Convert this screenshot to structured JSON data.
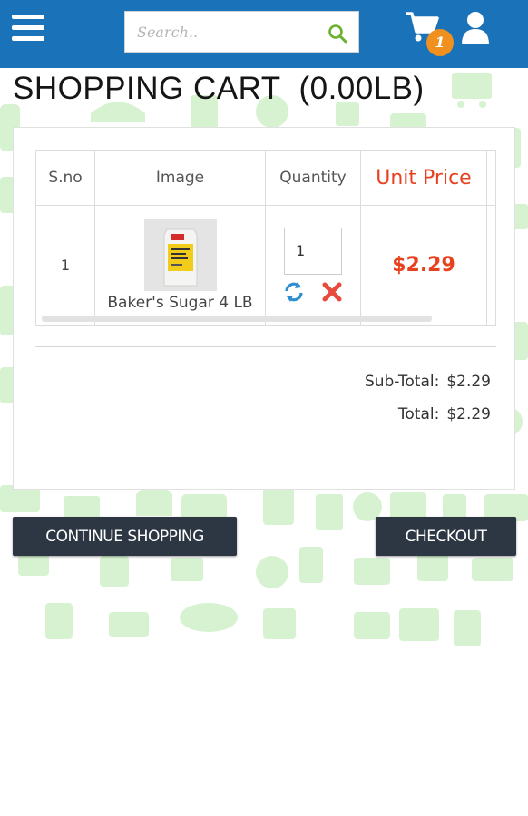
{
  "header": {
    "search_placeholder": "Search..",
    "cart_count": "1",
    "brand_color": "#1a73b8",
    "badge_color": "#f0901f"
  },
  "page": {
    "title": "SHOPPING CART  (0.00LB)"
  },
  "cart_table": {
    "columns": [
      "S.no",
      "Image",
      "Quantity",
      "Unit Price"
    ],
    "rows": [
      {
        "sno": "1",
        "product_name": "Baker's Sugar 4 LB",
        "quantity": "1",
        "unit_price": "$2.29"
      }
    ]
  },
  "totals": {
    "subtotal_label": "Sub-Total:",
    "subtotal_value": "$2.29",
    "total_label": "Total:",
    "total_value": "$2.29"
  },
  "actions": {
    "continue_label": "CONTINUE SHOPPING",
    "checkout_label": "CHECKOUT"
  },
  "colors": {
    "price": "#e8411f",
    "button": "#2c3743",
    "pattern": "#cdeec6"
  }
}
